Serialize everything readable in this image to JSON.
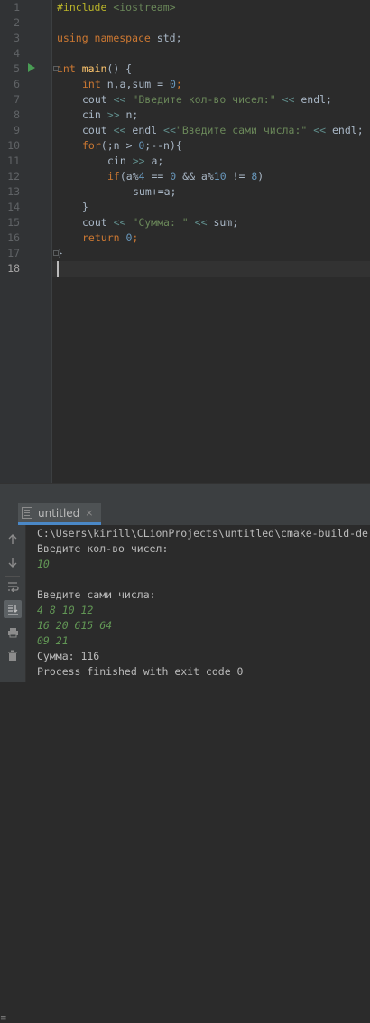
{
  "editor": {
    "line_numbers": [
      "1",
      "2",
      "3",
      "4",
      "5",
      "6",
      "7",
      "8",
      "9",
      "10",
      "11",
      "12",
      "13",
      "14",
      "15",
      "16",
      "17",
      "18"
    ],
    "lines": {
      "l1_directive": "#include",
      "l1_header": " <iostream>",
      "l3_using": "using",
      "l3_namespace": " namespace",
      "l3_std": " std;",
      "l5_int": "int",
      "l5_main": " main",
      "l5_rest": "() {",
      "l6_int": "int",
      "l6_vars": " n,a,sum = ",
      "l6_zero": "0",
      "l6_semi": ";",
      "l7_cout": "cout ",
      "l7_op": "<<",
      "l7_str": " \"Введите кол-во чисел:\"",
      "l7_op2": " <<",
      "l7_endl": " endl;",
      "l8_cin": "cin ",
      "l8_op": ">>",
      "l8_rest": " n;",
      "l9_cout": "cout ",
      "l9_op": "<<",
      "l9_endl": " endl ",
      "l9_op2": "<<",
      "l9_str": "\"Введите сами числа:\"",
      "l9_op3": " <<",
      "l9_endl2": " endl;",
      "l10_for": "for",
      "l10_rest": "(;n > ",
      "l10_zero": "0",
      "l10_rest2": ";--n){",
      "l11_cin": "cin ",
      "l11_op": ">>",
      "l11_rest": " a;",
      "l12_if": "if",
      "l12_a": "(a%",
      "l12_4": "4",
      "l12_eq": " == ",
      "l12_0": "0",
      "l12_and": " && a%",
      "l12_10": "10",
      "l12_ne": " != ",
      "l12_8": "8",
      "l12_close": ")",
      "l13": "sum+=a;",
      "l14": "}",
      "l15_cout": "cout ",
      "l15_op": "<<",
      "l15_str": " \"Сумма: \"",
      "l15_op2": " <<",
      "l15_rest": " sum;",
      "l16_return": "return",
      "l16_zero": " 0",
      "l16_semi": ";",
      "l17": "}"
    }
  },
  "run_window": {
    "tab_label": "untitled",
    "tab_close": "×",
    "edge_mark": "≡",
    "toolbar_icons": [
      "arrow-up-icon",
      "arrow-down-icon",
      "soft-wrap-icon",
      "scroll-to-end-icon",
      "print-icon",
      "trash-icon"
    ],
    "console": {
      "path": "C:\\Users\\kirill\\CLionProjects\\untitled\\cmake-build-de",
      "prompt1": "Введите кол-во чисел:",
      "input1": "10",
      "blank": "",
      "prompt2": "Введите сами числа:",
      "input2": "4 8 10 12",
      "input3": "16 20 615 64",
      "input4": "09 21",
      "result": "Сумма: 116",
      "exit": "Process finished with exit code 0"
    }
  },
  "colors": {
    "editor_bg": "#2b2b2b",
    "keyword": "#cc7832",
    "string": "#6a8759",
    "number": "#6897bb",
    "input_text": "#629755",
    "run_icon": "#499c54"
  }
}
